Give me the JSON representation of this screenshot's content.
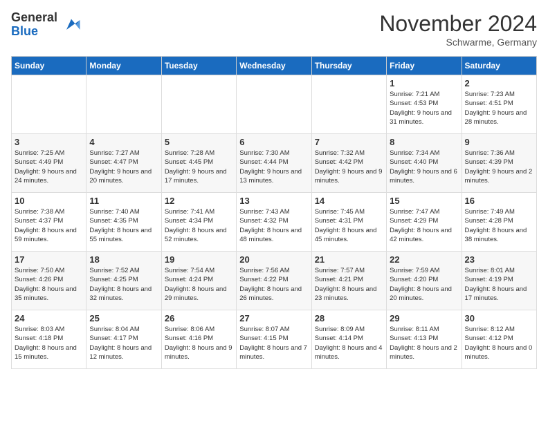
{
  "header": {
    "logo_general": "General",
    "logo_blue": "Blue",
    "month_title": "November 2024",
    "subtitle": "Schwarme, Germany"
  },
  "weekdays": [
    "Sunday",
    "Monday",
    "Tuesday",
    "Wednesday",
    "Thursday",
    "Friday",
    "Saturday"
  ],
  "weeks": [
    [
      {
        "day": "",
        "info": ""
      },
      {
        "day": "",
        "info": ""
      },
      {
        "day": "",
        "info": ""
      },
      {
        "day": "",
        "info": ""
      },
      {
        "day": "",
        "info": ""
      },
      {
        "day": "1",
        "info": "Sunrise: 7:21 AM\nSunset: 4:53 PM\nDaylight: 9 hours and 31 minutes."
      },
      {
        "day": "2",
        "info": "Sunrise: 7:23 AM\nSunset: 4:51 PM\nDaylight: 9 hours and 28 minutes."
      }
    ],
    [
      {
        "day": "3",
        "info": "Sunrise: 7:25 AM\nSunset: 4:49 PM\nDaylight: 9 hours and 24 minutes."
      },
      {
        "day": "4",
        "info": "Sunrise: 7:27 AM\nSunset: 4:47 PM\nDaylight: 9 hours and 20 minutes."
      },
      {
        "day": "5",
        "info": "Sunrise: 7:28 AM\nSunset: 4:45 PM\nDaylight: 9 hours and 17 minutes."
      },
      {
        "day": "6",
        "info": "Sunrise: 7:30 AM\nSunset: 4:44 PM\nDaylight: 9 hours and 13 minutes."
      },
      {
        "day": "7",
        "info": "Sunrise: 7:32 AM\nSunset: 4:42 PM\nDaylight: 9 hours and 9 minutes."
      },
      {
        "day": "8",
        "info": "Sunrise: 7:34 AM\nSunset: 4:40 PM\nDaylight: 9 hours and 6 minutes."
      },
      {
        "day": "9",
        "info": "Sunrise: 7:36 AM\nSunset: 4:39 PM\nDaylight: 9 hours and 2 minutes."
      }
    ],
    [
      {
        "day": "10",
        "info": "Sunrise: 7:38 AM\nSunset: 4:37 PM\nDaylight: 8 hours and 59 minutes."
      },
      {
        "day": "11",
        "info": "Sunrise: 7:40 AM\nSunset: 4:35 PM\nDaylight: 8 hours and 55 minutes."
      },
      {
        "day": "12",
        "info": "Sunrise: 7:41 AM\nSunset: 4:34 PM\nDaylight: 8 hours and 52 minutes."
      },
      {
        "day": "13",
        "info": "Sunrise: 7:43 AM\nSunset: 4:32 PM\nDaylight: 8 hours and 48 minutes."
      },
      {
        "day": "14",
        "info": "Sunrise: 7:45 AM\nSunset: 4:31 PM\nDaylight: 8 hours and 45 minutes."
      },
      {
        "day": "15",
        "info": "Sunrise: 7:47 AM\nSunset: 4:29 PM\nDaylight: 8 hours and 42 minutes."
      },
      {
        "day": "16",
        "info": "Sunrise: 7:49 AM\nSunset: 4:28 PM\nDaylight: 8 hours and 38 minutes."
      }
    ],
    [
      {
        "day": "17",
        "info": "Sunrise: 7:50 AM\nSunset: 4:26 PM\nDaylight: 8 hours and 35 minutes."
      },
      {
        "day": "18",
        "info": "Sunrise: 7:52 AM\nSunset: 4:25 PM\nDaylight: 8 hours and 32 minutes."
      },
      {
        "day": "19",
        "info": "Sunrise: 7:54 AM\nSunset: 4:24 PM\nDaylight: 8 hours and 29 minutes."
      },
      {
        "day": "20",
        "info": "Sunrise: 7:56 AM\nSunset: 4:22 PM\nDaylight: 8 hours and 26 minutes."
      },
      {
        "day": "21",
        "info": "Sunrise: 7:57 AM\nSunset: 4:21 PM\nDaylight: 8 hours and 23 minutes."
      },
      {
        "day": "22",
        "info": "Sunrise: 7:59 AM\nSunset: 4:20 PM\nDaylight: 8 hours and 20 minutes."
      },
      {
        "day": "23",
        "info": "Sunrise: 8:01 AM\nSunset: 4:19 PM\nDaylight: 8 hours and 17 minutes."
      }
    ],
    [
      {
        "day": "24",
        "info": "Sunrise: 8:03 AM\nSunset: 4:18 PM\nDaylight: 8 hours and 15 minutes."
      },
      {
        "day": "25",
        "info": "Sunrise: 8:04 AM\nSunset: 4:17 PM\nDaylight: 8 hours and 12 minutes."
      },
      {
        "day": "26",
        "info": "Sunrise: 8:06 AM\nSunset: 4:16 PM\nDaylight: 8 hours and 9 minutes."
      },
      {
        "day": "27",
        "info": "Sunrise: 8:07 AM\nSunset: 4:15 PM\nDaylight: 8 hours and 7 minutes."
      },
      {
        "day": "28",
        "info": "Sunrise: 8:09 AM\nSunset: 4:14 PM\nDaylight: 8 hours and 4 minutes."
      },
      {
        "day": "29",
        "info": "Sunrise: 8:11 AM\nSunset: 4:13 PM\nDaylight: 8 hours and 2 minutes."
      },
      {
        "day": "30",
        "info": "Sunrise: 8:12 AM\nSunset: 4:12 PM\nDaylight: 8 hours and 0 minutes."
      }
    ]
  ]
}
